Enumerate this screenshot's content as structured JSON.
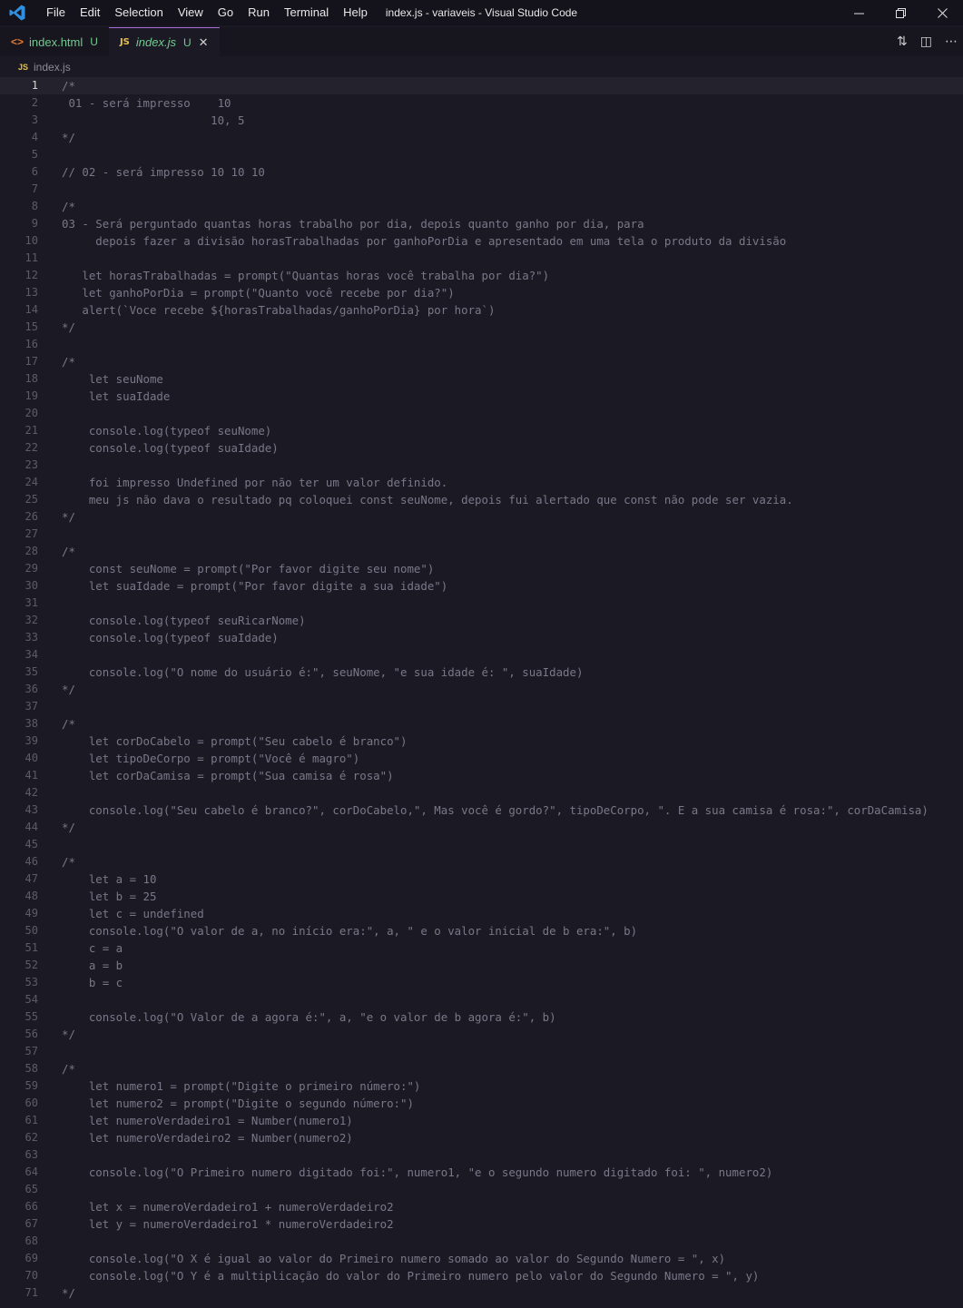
{
  "window": {
    "title": "index.js - variaveis - Visual Studio Code",
    "menu": [
      "File",
      "Edit",
      "Selection",
      "View",
      "Go",
      "Run",
      "Terminal",
      "Help"
    ]
  },
  "tabs": [
    {
      "label": "index.html",
      "status": "U",
      "icon": "html-icon",
      "active": false
    },
    {
      "label": "index.js",
      "status": "U",
      "icon": "js-icon",
      "active": true
    }
  ],
  "breadcrumb": {
    "icon_text": "JS",
    "file": "index.js"
  },
  "editor": {
    "current_line": 1,
    "lines": [
      "/*",
      " 01 - será impresso    10",
      "                      10, 5",
      "*/",
      "",
      "// 02 - será impresso 10 10 10",
      "",
      "/*",
      "03 - Será perguntado quantas horas trabalho por dia, depois quanto ganho por dia, para",
      "     depois fazer a divisão horasTrabalhadas por ganhoPorDia e apresentado em uma tela o produto da divisão",
      "",
      "   let horasTrabalhadas = prompt(\"Quantas horas você trabalha por dia?\")",
      "   let ganhoPorDia = prompt(\"Quanto você recebe por dia?\")",
      "   alert(`Voce recebe ${horasTrabalhadas/ganhoPorDia} por hora`)",
      "*/",
      "",
      "/*",
      "    let seuNome",
      "    let suaIdade",
      "",
      "    console.log(typeof seuNome)",
      "    console.log(typeof suaIdade)",
      "",
      "    foi impresso Undefined por não ter um valor definido.",
      "    meu js não dava o resultado pq coloquei const seuNome, depois fui alertado que const não pode ser vazia.",
      "*/",
      "",
      "/*",
      "    const seuNome = prompt(\"Por favor digite seu nome\")",
      "    let suaIdade = prompt(\"Por favor digite a sua idade\")",
      "",
      "    console.log(typeof seuRicarNome)",
      "    console.log(typeof suaIdade)",
      "",
      "    console.log(\"O nome do usuário é:\", seuNome, \"e sua idade é: \", suaIdade)",
      "*/",
      "",
      "/*",
      "    let corDoCabelo = prompt(\"Seu cabelo é branco\")",
      "    let tipoDeCorpo = prompt(\"Você é magro\")",
      "    let corDaCamisa = prompt(\"Sua camisa é rosa\")",
      "",
      "    console.log(\"Seu cabelo é branco?\", corDoCabelo,\", Mas você é gordo?\", tipoDeCorpo, \". E a sua camisa é rosa:\", corDaCamisa)",
      "*/",
      "",
      "/*",
      "    let a = 10",
      "    let b = 25",
      "    let c = undefined",
      "    console.log(\"O valor de a, no início era:\", a, \" e o valor inicial de b era:\", b)",
      "    c = a",
      "    a = b",
      "    b = c",
      "",
      "    console.log(\"O Valor de a agora é:\", a, \"e o valor de b agora é:\", b)",
      "*/",
      "",
      "/*",
      "    let numero1 = prompt(\"Digite o primeiro número:\")",
      "    let numero2 = prompt(\"Digite o segundo número:\")",
      "    let numeroVerdadeiro1 = Number(numero1)",
      "    let numeroVerdadeiro2 = Number(numero2)",
      "",
      "    console.log(\"O Primeiro numero digitado foi:\", numero1, \"e o segundo numero digitado foi: \", numero2)",
      "",
      "    let x = numeroVerdadeiro1 + numeroVerdadeiro2",
      "    let y = numeroVerdadeiro1 * numeroVerdadeiro2",
      "",
      "    console.log(\"O X é igual ao valor do Primeiro numero somado ao valor do Segundo Numero = \", x)",
      "    console.log(\"O Y é a multiplicação do valor do Primeiro numero pelo valor do Segundo Numero = \", y)",
      "*/"
    ]
  }
}
